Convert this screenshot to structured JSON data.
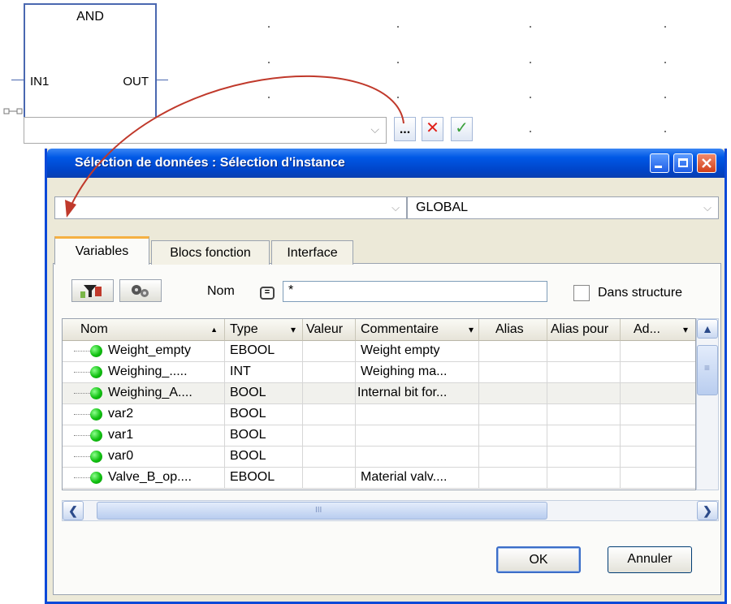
{
  "editor": {
    "block": {
      "name": "AND",
      "input_pin": "IN1",
      "output_pin": "OUT"
    },
    "input_value": "",
    "browse_label": "...",
    "cancel_glyph": "✕",
    "confirm_glyph": "✓"
  },
  "dialog": {
    "title": "Sélection de données : Sélection d'instance",
    "scope_value": "",
    "scope_glyph": "⌵",
    "global_value": "GLOBAL",
    "tabs": [
      {
        "label": "Variables",
        "active": true
      },
      {
        "label": "Blocs fonction",
        "active": false
      },
      {
        "label": "Interface",
        "active": false
      }
    ],
    "filter": {
      "label": "Nom",
      "equals_glyph": "=",
      "value": "*"
    },
    "structure_checkbox": {
      "label": "Dans structure",
      "checked": false
    },
    "grid": {
      "columns": [
        "Nom",
        "Type",
        "Valeur",
        "Commentaire",
        "Alias",
        "Alias pour",
        "Ad..."
      ],
      "header_glyphs": {
        "sort_asc": "▲",
        "dropdown": "▾"
      },
      "rows": [
        {
          "name": "Weight_empty",
          "type": "EBOOL",
          "value": "",
          "comment": "Weight empty",
          "alias": "",
          "alias_of": "",
          "address": ""
        },
        {
          "name": "Weighing_.....",
          "type": "INT",
          "value": "",
          "comment": "Weighing ma...",
          "alias": "",
          "alias_of": "",
          "address": ""
        },
        {
          "name": "Weighing_A....",
          "type": "BOOL",
          "value": "",
          "comment": "Internal bit for...",
          "alias": "",
          "alias_of": "",
          "address": ""
        },
        {
          "name": "var2",
          "type": "BOOL",
          "value": "",
          "comment": "",
          "alias": "",
          "alias_of": "",
          "address": ""
        },
        {
          "name": "var1",
          "type": "BOOL",
          "value": "",
          "comment": "",
          "alias": "",
          "alias_of": "",
          "address": ""
        },
        {
          "name": "var0",
          "type": "BOOL",
          "value": "",
          "comment": "",
          "alias": "",
          "alias_of": "",
          "address": ""
        },
        {
          "name": "Valve_B_op....",
          "type": "EBOOL",
          "value": "",
          "comment": "Material valv....",
          "alias": "",
          "alias_of": "",
          "address": ""
        }
      ]
    },
    "scrollbar_glyphs": {
      "up": "▲",
      "left": "❮",
      "right": "❯",
      "grip": "III",
      "vgrip": "≡"
    },
    "ok_label": "OK",
    "cancel_label": "Annuler"
  },
  "colors": {
    "title_bar": "#0058e6",
    "active_tab_accent": "#f5b143",
    "status_ok": "#10c010",
    "arrow": "#c0392b"
  }
}
